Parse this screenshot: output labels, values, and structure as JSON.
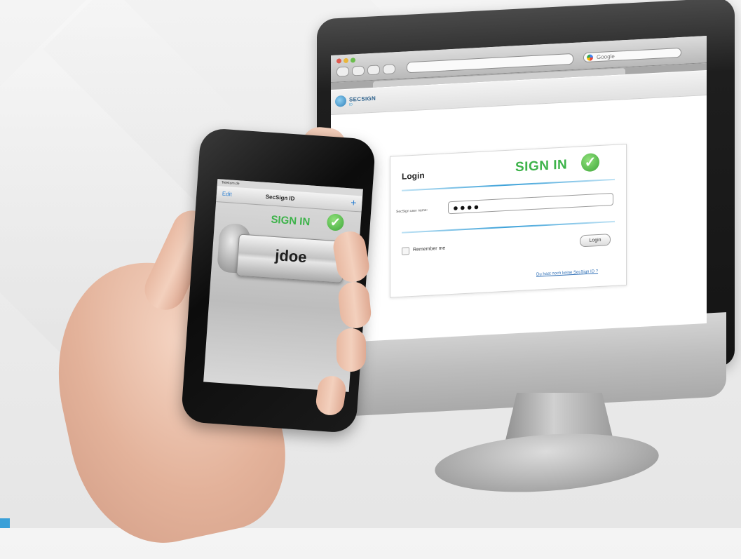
{
  "browser": {
    "search_placeholder": "Google"
  },
  "site": {
    "logo_text": "SECSIGN",
    "logo_subtext": "ID"
  },
  "login_form": {
    "title": "Login",
    "sign_in_text": "SIGN IN",
    "field_label": "SecSign user name:",
    "password_value": "●●●●",
    "remember_label": "Remember me",
    "login_button": "Login",
    "register_link": "Du hast noch keine SecSign ID ?"
  },
  "phone_app": {
    "status": "Telekom.de",
    "edit_label": "Edit",
    "title": "SecSign ID",
    "add_icon": "+",
    "sign_in_text": "SIGN IN",
    "username": "jdoe"
  },
  "colors": {
    "accent_green": "#3db34a",
    "link_blue": "#2f6fb6",
    "brand_blue": "#3aa0d8"
  }
}
